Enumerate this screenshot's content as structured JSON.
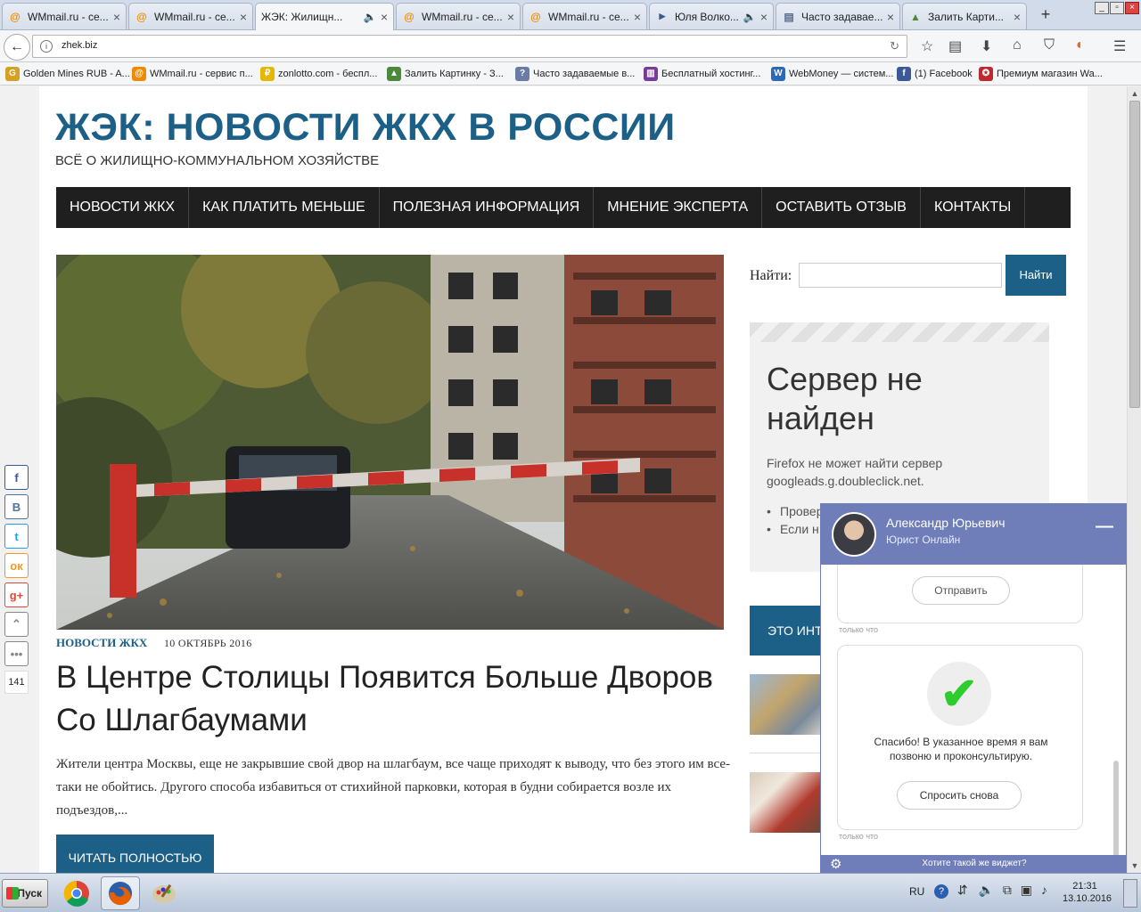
{
  "tabs": [
    {
      "title": "WMmail.ru - се...",
      "icon": "wmmail-icon",
      "active": false
    },
    {
      "title": "WMmail.ru - се...",
      "icon": "wmmail-icon",
      "active": false
    },
    {
      "title": "ЖЭК: Жилищн...",
      "icon": "speaker-icon",
      "active": true
    },
    {
      "title": "WMmail.ru - се...",
      "icon": "wmmail-icon",
      "active": false
    },
    {
      "title": "WMmail.ru - се...",
      "icon": "wmmail-icon",
      "active": false
    },
    {
      "title": "Юля Волко...",
      "icon": "play-icon",
      "active": false
    },
    {
      "title": "Часто задавае...",
      "icon": "page-icon",
      "active": false
    },
    {
      "title": "Залить Карти...",
      "icon": "image-icon",
      "active": false
    }
  ],
  "newtab": "+",
  "address": {
    "url": "zhek.biz"
  },
  "bookmarks": [
    {
      "label": "Golden Mines RUB - A...",
      "color": "#d8a020",
      "glyph": "G"
    },
    {
      "label": "WMmail.ru - сервис п...",
      "color": "#f08a00",
      "glyph": "@"
    },
    {
      "label": "zonlotto.com - беспл...",
      "color": "#e6b800",
      "glyph": "₽"
    },
    {
      "label": "Залить Картинку - З...",
      "color": "#4a8a3a",
      "glyph": "▲"
    },
    {
      "label": "Часто задаваемые в...",
      "color": "#6a7ba8",
      "glyph": "?"
    },
    {
      "label": "Бесплатный хостинг...",
      "color": "#7a3a9a",
      "glyph": "▥"
    },
    {
      "label": "WebMoney — систем...",
      "color": "#2a6ab8",
      "glyph": "W"
    },
    {
      "label": "(1) Facebook",
      "color": "#3b5998",
      "glyph": "f"
    },
    {
      "label": "Премиум магазин Wa...",
      "color": "#c0282e",
      "glyph": "✪"
    }
  ],
  "site": {
    "title": "ЖЭК: НОВОСТИ ЖКХ В РОССИИ",
    "subtitle": "ВСЁ О ЖИЛИЩНО-КОММУНАЛЬНОМ ХОЗЯЙСТВЕ",
    "nav": [
      "НОВОСТИ ЖКХ",
      "КАК ПЛАТИТЬ МЕНЬШЕ",
      "ПОЛЕЗНАЯ ИНФОРМАЦИЯ",
      "МНЕНИЕ ЭКСПЕРТА",
      "ОСТАВИТЬ ОТЗЫВ",
      "КОНТАКТЫ"
    ]
  },
  "post": {
    "category": "НОВОСТИ ЖКХ",
    "date": "10 ОКТЯБРЬ 2016",
    "title": "В Центре Столицы Появится Больше Дворов Со Шлагбаумами",
    "excerpt": "Жители центра Москвы, еще не закрывшие свой двор на шлагбаум, все чаще приходят к выводу, что без этого им все-таки не обойтись. Другого способа избавиться от стихийной парковки, которая в будни собирается возле их подъездов,...",
    "read_more": "ЧИТАТЬ ПОЛНОСТЬЮ"
  },
  "sidebar": {
    "search_label": "Найти:",
    "search_value": "",
    "search_button": "Найти",
    "error_title": "Сервер не найден",
    "error_desc": "Firefox не может найти сервер googleads.g.doubleclick.net.",
    "error_items": [
      "Провер набор вместо",
      "Если н"
    ],
    "blue_label": "ЭТО ИНТ"
  },
  "share": {
    "buttons": [
      {
        "name": "facebook",
        "glyph": "f",
        "color": "#3b5998"
      },
      {
        "name": "vkontakte",
        "glyph": "В",
        "color": "#4c75a3"
      },
      {
        "name": "twitter",
        "glyph": "t",
        "color": "#1da1f2"
      },
      {
        "name": "odnoklassniki",
        "glyph": "ок",
        "color": "#f59a1e"
      },
      {
        "name": "googleplus",
        "glyph": "g+",
        "color": "#dd4b39"
      },
      {
        "name": "up",
        "glyph": "⌃",
        "color": "#888888"
      },
      {
        "name": "more",
        "glyph": "•••",
        "color": "#888888"
      }
    ],
    "count": "141"
  },
  "chat": {
    "name": "Александр Юрьевич",
    "role": "Юрист Онлайн",
    "minimize": "—",
    "send_button": "Отправить",
    "timestamp": "только что",
    "thanks": "Спасибо! В указанное время я вам позвоню и проконсультирую.",
    "ask_again": "Спросить снова",
    "footer": "Хотите такой же виджет?"
  },
  "taskbar": {
    "start": "Пуск",
    "lang": "RU",
    "time": "21:31",
    "date": "13.10.2016"
  },
  "colors": {
    "brand": "#1d6087",
    "nav": "#1f1f1f",
    "chat": "#6f7eb8"
  }
}
